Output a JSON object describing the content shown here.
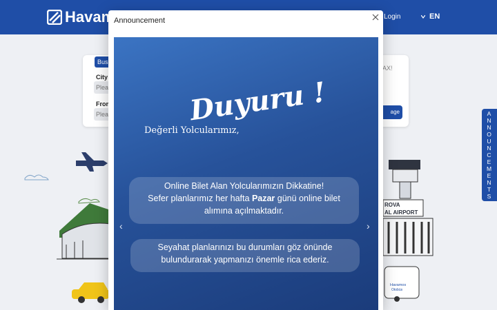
{
  "header": {
    "logo_text": "Havam",
    "login_label": "Login",
    "language": "EN"
  },
  "booking_panel": {
    "tab_label": "Bus",
    "city_label": "City",
    "city_placeholder": "Plea",
    "from_label": "From",
    "from_placeholder": "Plea",
    "right_text": "AX!",
    "action_label": "age"
  },
  "side_tab": {
    "letters": [
      "A",
      "N",
      "N",
      "O",
      "U",
      "N",
      "C",
      "E",
      "M",
      "E",
      "N",
      "T",
      "S"
    ]
  },
  "modal": {
    "title": "Announcement",
    "slide": {
      "heading": "Duyuru !",
      "greeting": "Değerli Yolcularımız,",
      "message1_line1": "Online Bilet Alan Yolcularımızın Dikkatine!",
      "message1_line2_pre": "Sefer planlarımız her hafta ",
      "message1_line2_bold": "Pazar",
      "message1_line2_post": " günü online bilet",
      "message1_line3": "alımına açılmaktadır.",
      "message2_line1": "Seyahat planlarınızı bu durumları göz önünde",
      "message2_line2": "bulundurarak yapmanızı önemle rica ederiz."
    },
    "prev_arrow": "‹",
    "next_arrow": "›"
  },
  "illustration": {
    "airport_sign_line1": "ROVA",
    "airport_sign_line2": "AL AIRPORT",
    "bus_brand": "Havamos",
    "bus_sub": "Otobüs"
  },
  "colors": {
    "brand": "#1f4ea7",
    "slide_top": "#3b74c3",
    "slide_bottom": "#1b3c7b"
  }
}
